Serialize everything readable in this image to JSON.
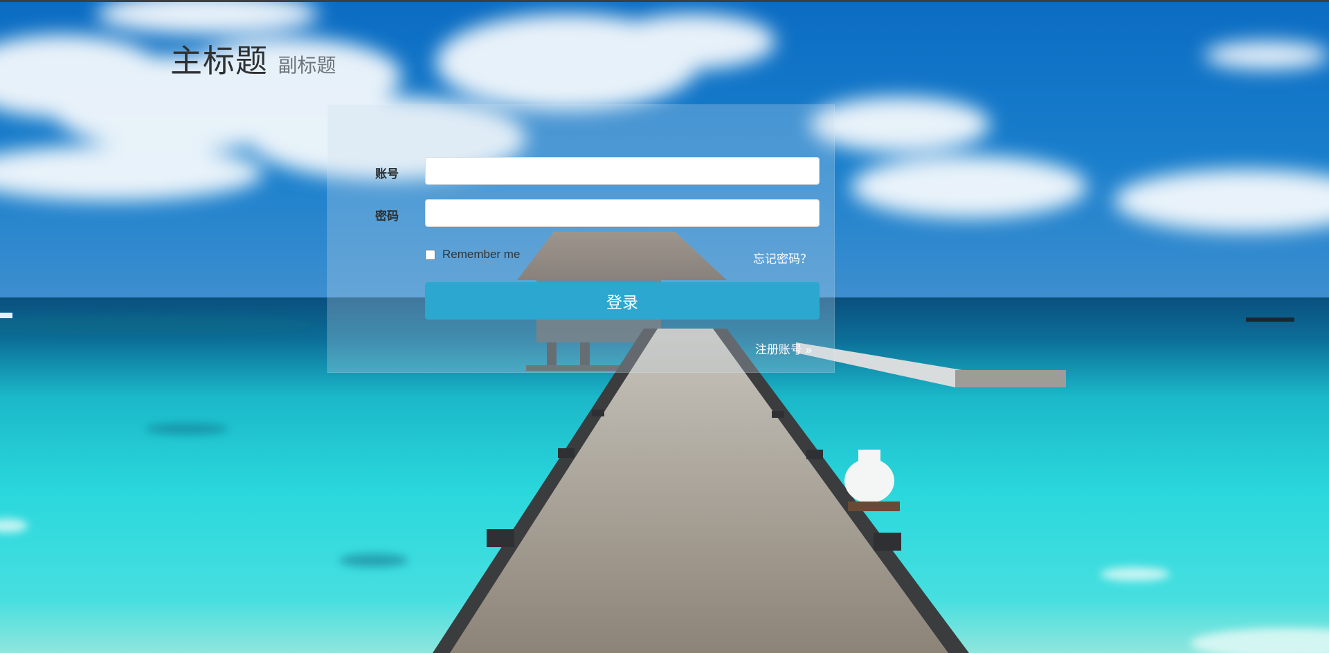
{
  "header": {
    "title": "主标题",
    "subtitle": "副标题"
  },
  "form": {
    "account_label": "账号",
    "account_value": "",
    "password_label": "密码",
    "password_value": "",
    "remember_label": "Remember me",
    "remember_checked": false,
    "forgot_link": "忘记密码？",
    "login_button": "登录",
    "register_link": "注册账号 »"
  },
  "colors": {
    "button_accent": "#2ba7d0",
    "sky_top": "#0a6fc4",
    "sea_turquoise": "#28d6da",
    "panel_overlay": "rgba(205,224,238,0.28)"
  }
}
